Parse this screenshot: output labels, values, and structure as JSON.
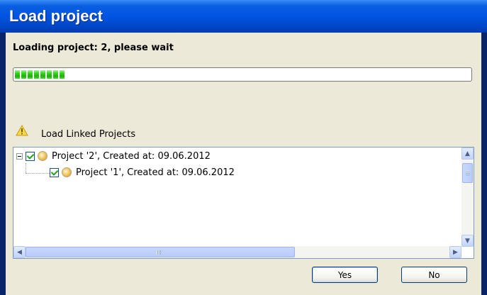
{
  "window": {
    "title": "Load project"
  },
  "status": {
    "message": "Loading project: 2, please wait",
    "progress_fraction": 0.12
  },
  "section": {
    "label": "Load Linked Projects",
    "icon": "warning-icon"
  },
  "tree": {
    "nodes": [
      {
        "label": "Project '2', Created at: 09.06.2012",
        "checked": true,
        "expanded": true,
        "level": 0
      },
      {
        "label": "Project '1', Created at: 09.06.2012",
        "checked": true,
        "level": 1
      }
    ]
  },
  "buttons": {
    "yes": "Yes",
    "no": "No"
  },
  "colors": {
    "title_bar": "#0054E3",
    "dialog_bg": "#ECE9D8",
    "progress": "#37D41F"
  }
}
